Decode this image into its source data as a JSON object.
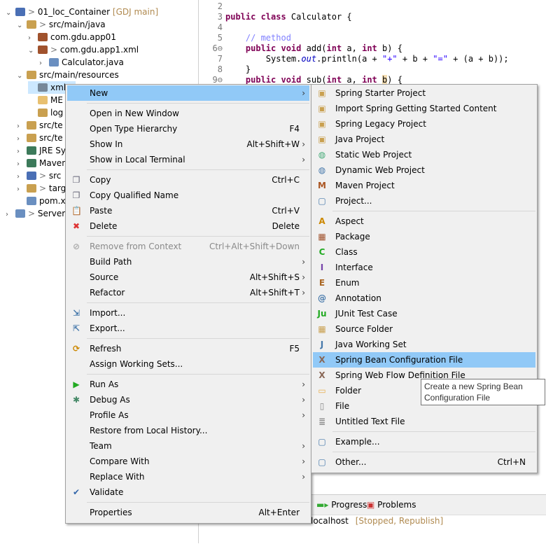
{
  "explorer": {
    "items": [
      {
        "label": "01_loc_Container",
        "decor": "[GDJ main]",
        "prefix": "> ",
        "indent": 0,
        "chev": "v",
        "color": "#4a6fb5"
      },
      {
        "label": "src/main/java",
        "prefix": "> ",
        "indent": 1,
        "chev": "v",
        "color": "#c9a050"
      },
      {
        "label": "com.gdu.app01",
        "indent": 2,
        "chev": ">",
        "color": "#a0522d"
      },
      {
        "label": "com.gdu.app1.xml",
        "prefix": "> ",
        "indent": 2,
        "chev": "v",
        "color": "#a0522d"
      },
      {
        "label": "Calculator.java",
        "indent": 3,
        "chev": ">",
        "color": "#6a8fc0"
      },
      {
        "label": "src/main/resources",
        "indent": 1,
        "chev": "v",
        "color": "#c9a050"
      },
      {
        "label": "xml",
        "indent": 2,
        "chev": "",
        "color": "#778899",
        "selected": true
      },
      {
        "label": "ME",
        "indent": 2,
        "chev": "",
        "color": "#e8c070"
      },
      {
        "label": "log",
        "indent": 2,
        "chev": "",
        "color": "#c9a050"
      },
      {
        "label": "src/te",
        "indent": 1,
        "chev": ">",
        "color": "#c9a050"
      },
      {
        "label": "src/te",
        "indent": 1,
        "chev": ">",
        "color": "#c9a050"
      },
      {
        "label": "JRE Sy",
        "indent": 1,
        "chev": ">",
        "color": "#3c7a5a"
      },
      {
        "label": "Maven",
        "indent": 1,
        "chev": ">",
        "color": "#3c7a5a"
      },
      {
        "label": "src",
        "prefix": "> ",
        "indent": 1,
        "chev": ">",
        "color": "#4a6fb5"
      },
      {
        "label": "targ",
        "prefix": "> ",
        "indent": 1,
        "chev": ">",
        "color": "#c9a050"
      },
      {
        "label": "pom.x",
        "indent": 1,
        "chev": "",
        "color": "#6a8fc0"
      },
      {
        "label": "Servers",
        "prefix": "> ",
        "indent": 0,
        "chev": ">",
        "color": "#6a8fc0"
      }
    ]
  },
  "editor": {
    "lines": [
      {
        "n": "2",
        "html": ""
      },
      {
        "n": "3",
        "html": "<span class='kw'>public class</span> Calculator {"
      },
      {
        "n": "4",
        "html": ""
      },
      {
        "n": "5",
        "html": "    <span class='cm'>// method</span>"
      },
      {
        "n": "6⊖",
        "html": "    <span class='kw'>public void</span> add(<span class='kw'>int</span> a, <span class='kw'>int</span> b) {"
      },
      {
        "n": "7",
        "html": "        System.<span class='it'>out</span>.println(a + <span class='st'>\"+\"</span> + b + <span class='st'>\"=\"</span> + (a + b));"
      },
      {
        "n": "8",
        "html": "    }"
      },
      {
        "n": "9⊖",
        "html": "    <span class='kw'>public void</span> sub(<span class='kw'>int</span> a, <span class='kw'>int</span> <span style='background:#f5deb3'>b</span>) {"
      }
    ]
  },
  "bottom": {
    "tabs": [
      "Progress",
      "Problems"
    ],
    "server": "localhost",
    "server_status": "[Stopped, Republish]"
  },
  "context_menu": {
    "items": [
      {
        "label": "New",
        "arrow": true,
        "hl": true
      },
      "-",
      {
        "label": "Open in New Window"
      },
      {
        "label": "Open Type Hierarchy",
        "shortcut": "F4"
      },
      {
        "label": "Show In",
        "shortcut": "Alt+Shift+W",
        "arrow": true
      },
      {
        "label": "Show in Local Terminal",
        "arrow": true
      },
      "-",
      {
        "label": "Copy",
        "shortcut": "Ctrl+C",
        "icon": "copy-icon",
        "g": "❐",
        "c": "#667"
      },
      {
        "label": "Copy Qualified Name",
        "icon": "copy-qualified-icon",
        "g": "❐",
        "c": "#667"
      },
      {
        "label": "Paste",
        "shortcut": "Ctrl+V",
        "icon": "paste-icon",
        "g": "📋",
        "c": "#a86"
      },
      {
        "label": "Delete",
        "shortcut": "Delete",
        "icon": "delete-icon",
        "g": "✖",
        "c": "#d33"
      },
      "-",
      {
        "label": "Remove from Context",
        "shortcut": "Ctrl+Alt+Shift+Down",
        "dis": true,
        "icon": "remove-context-icon",
        "g": "⊘",
        "c": "#aaa"
      },
      {
        "label": "Build Path",
        "arrow": true
      },
      {
        "label": "Source",
        "shortcut": "Alt+Shift+S",
        "arrow": true
      },
      {
        "label": "Refactor",
        "shortcut": "Alt+Shift+T",
        "arrow": true
      },
      "-",
      {
        "label": "Import...",
        "icon": "import-icon",
        "g": "⇲",
        "c": "#47a"
      },
      {
        "label": "Export...",
        "icon": "export-icon",
        "g": "⇱",
        "c": "#47a"
      },
      "-",
      {
        "label": "Refresh",
        "shortcut": "F5",
        "icon": "refresh-icon",
        "g": "⟳",
        "c": "#c80"
      },
      {
        "label": "Assign Working Sets..."
      },
      "-",
      {
        "label": "Run As",
        "arrow": true,
        "icon": "run-icon",
        "g": "▶",
        "c": "#2a2"
      },
      {
        "label": "Debug As",
        "arrow": true,
        "icon": "debug-icon",
        "g": "✱",
        "c": "#486"
      },
      {
        "label": "Profile As",
        "arrow": true
      },
      {
        "label": "Restore from Local History..."
      },
      {
        "label": "Team",
        "arrow": true
      },
      {
        "label": "Compare With",
        "arrow": true
      },
      {
        "label": "Replace With",
        "arrow": true
      },
      {
        "label": "Validate",
        "icon": "check-icon",
        "g": "✔",
        "c": "#36a"
      },
      "-",
      {
        "label": "Properties",
        "shortcut": "Alt+Enter"
      }
    ]
  },
  "submenu": {
    "items": [
      {
        "label": "Spring Starter Project",
        "icon": "spring-starter-icon",
        "g": "▣",
        "c": "#c9a050"
      },
      {
        "label": "Import Spring Getting Started Content",
        "icon": "spring-import-icon",
        "g": "▣",
        "c": "#c9a050"
      },
      {
        "label": "Spring Legacy Project",
        "icon": "spring-legacy-icon",
        "g": "▣",
        "c": "#c9a050"
      },
      {
        "label": "Java Project",
        "icon": "java-project-icon",
        "g": "▣",
        "c": "#c9a050"
      },
      {
        "label": "Static Web Project",
        "icon": "static-web-icon",
        "g": "◍",
        "c": "#4a7"
      },
      {
        "label": "Dynamic Web Project",
        "icon": "dynamic-web-icon",
        "g": "◍",
        "c": "#47a"
      },
      {
        "label": "Maven Project",
        "icon": "maven-icon",
        "g": "M",
        "c": "#a52"
      },
      {
        "label": "Project...",
        "icon": "project-icon",
        "g": "▢",
        "c": "#47a"
      },
      "-",
      {
        "label": "Aspect",
        "icon": "aspect-icon",
        "g": "A",
        "c": "#c80"
      },
      {
        "label": "Package",
        "icon": "package-icon",
        "g": "▦",
        "c": "#a0522d"
      },
      {
        "label": "Class",
        "icon": "class-icon",
        "g": "C",
        "c": "#2a2"
      },
      {
        "label": "Interface",
        "icon": "interface-icon",
        "g": "I",
        "c": "#74a"
      },
      {
        "label": "Enum",
        "icon": "enum-icon",
        "g": "E",
        "c": "#a62"
      },
      {
        "label": "Annotation",
        "icon": "annotation-icon",
        "g": "@",
        "c": "#47a"
      },
      {
        "label": "JUnit Test Case",
        "icon": "junit-icon",
        "g": "Ju",
        "c": "#2a2"
      },
      {
        "label": "Source Folder",
        "icon": "source-folder-icon",
        "g": "▦",
        "c": "#c9a050"
      },
      {
        "label": "Java Working Set",
        "icon": "working-set-icon",
        "g": "J",
        "c": "#47a"
      },
      {
        "label": "Spring Bean Configuration File",
        "hl": true,
        "icon": "spring-bean-icon",
        "g": "X",
        "c": "#865"
      },
      {
        "label": "Spring Web Flow Definition File",
        "icon": "spring-webflow-icon",
        "g": "X",
        "c": "#865"
      },
      {
        "label": "Folder",
        "icon": "folder-icon",
        "g": "▭",
        "c": "#e8b050"
      },
      {
        "label": "File",
        "icon": "file-icon",
        "g": "▯",
        "c": "#888"
      },
      {
        "label": "Untitled Text File",
        "icon": "text-file-icon",
        "g": "≣",
        "c": "#888"
      },
      "-",
      {
        "label": "Example...",
        "icon": "example-icon",
        "g": "▢",
        "c": "#47a"
      },
      "-",
      {
        "label": "Other...",
        "shortcut": "Ctrl+N",
        "icon": "other-icon",
        "g": "▢",
        "c": "#47a"
      }
    ]
  },
  "tooltip": "Create a new Spring Bean Configuration File"
}
